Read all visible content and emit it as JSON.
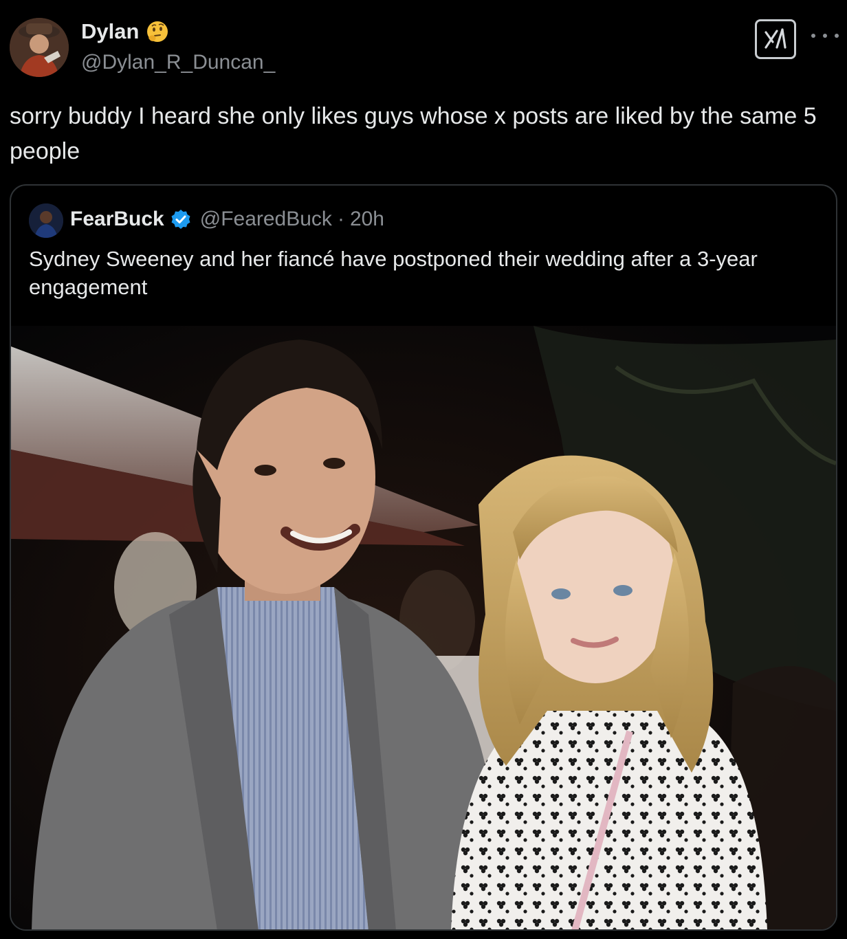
{
  "post": {
    "author_name": "Dylan",
    "author_handle": "@Dylan_R_Duncan_",
    "text": "sorry buddy I heard she only likes guys whose x posts are liked by the same 5 people",
    "status_emoji": "thinking-face-icon",
    "grok_icon": "grok-icon",
    "more_icon": "more-horizontal-icon"
  },
  "quote": {
    "author_name": "FearBuck",
    "author_handle": "@FearedBuck",
    "separator": "·",
    "time": "20h",
    "text": "Sydney Sweeney and her fiancé have postponed their wedding after a 3-year engagement",
    "verified_icon": "verified-badge-icon"
  },
  "colors": {
    "background": "#000000",
    "text_primary": "#e7e9ea",
    "text_secondary": "#8b8f94",
    "border": "#2f3336",
    "verified_blue": "#1d9bf0"
  }
}
